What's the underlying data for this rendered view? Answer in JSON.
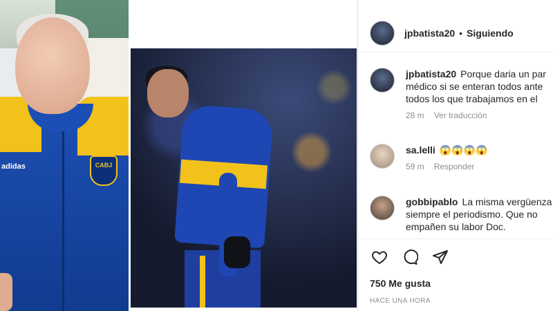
{
  "left_photo": {
    "jacket_brand": "adidas",
    "badge_text": "CABJ"
  },
  "post": {
    "username": "jpbatista20",
    "separator": "•",
    "follow_status": "Siguiendo",
    "comments": [
      {
        "user": "jpbatista20",
        "lines": [
          "Porque daria un par",
          "médico si se enteran todos ante",
          "todos los que trabajamos en el"
        ],
        "meta": [
          "28 m",
          "Ver traducción"
        ]
      },
      {
        "user": "sa.lelli",
        "lines": [
          "😱😱😱😱"
        ],
        "meta": [
          "59 m",
          "Responder"
        ]
      },
      {
        "user": "gobbipablo",
        "lines": [
          "La misma vergüenza",
          "siempre el periodismo. Que no",
          "empañen su labor Doc."
        ],
        "meta": []
      }
    ],
    "icons": [
      "heart-icon",
      "comment-icon",
      "share-icon"
    ],
    "likes": "750 Me gusta",
    "timestamp": "HACE UNA HORA",
    "colors": {
      "text": "#262626",
      "muted": "#8e8e8e",
      "boca_blue": "#1e47b4",
      "boca_gold": "#f2c21b"
    }
  }
}
